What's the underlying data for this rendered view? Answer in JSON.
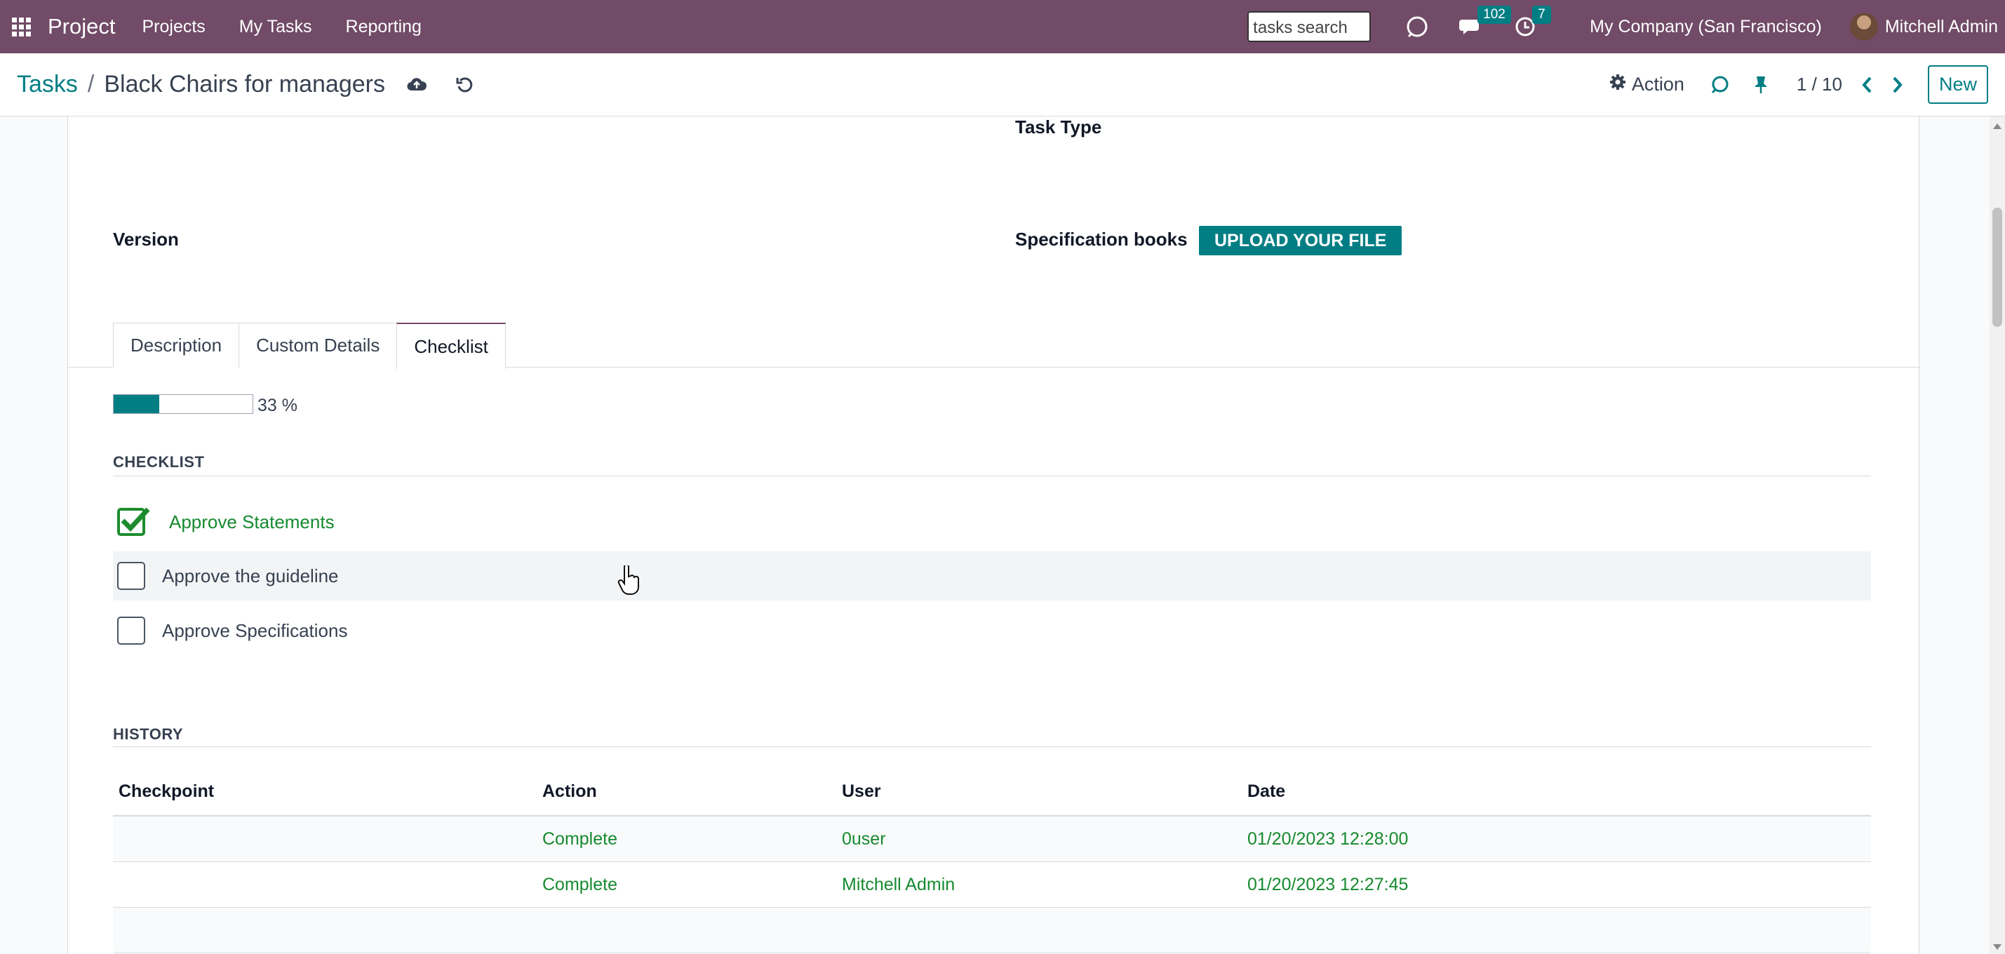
{
  "navbar": {
    "brand": "Project",
    "menu": [
      "Projects",
      "My Tasks",
      "Reporting"
    ],
    "search_placeholder": "tasks search",
    "messages_count": "102",
    "activities_count": "7",
    "company": "My Company (San Francisco)",
    "user": "Mitchell Admin"
  },
  "breadcrumb": {
    "parent": "Tasks",
    "separator": "/",
    "current": "Black Chairs for managers"
  },
  "control": {
    "action_label": "Action",
    "pager": "1 / 10",
    "new_label": "New"
  },
  "form": {
    "task_type_label": "Task Type",
    "version_label": "Version",
    "spec_books_label": "Specification books",
    "upload_label": "UPLOAD YOUR FILE"
  },
  "tabs": [
    {
      "label": "Description",
      "active": false
    },
    {
      "label": "Custom Details",
      "active": false
    },
    {
      "label": "Checklist",
      "active": true
    }
  ],
  "checklist": {
    "progress_percent": 33,
    "progress_text": "33 %",
    "section_title": "CHECKLIST",
    "items": [
      {
        "label": "Approve Statements",
        "done": true
      },
      {
        "label": "Approve the guideline",
        "done": false
      },
      {
        "label": "Approve Specifications",
        "done": false
      }
    ]
  },
  "history": {
    "section_title": "HISTORY",
    "columns": [
      "Checkpoint",
      "Action",
      "User",
      "Date"
    ],
    "rows": [
      {
        "checkpoint": "",
        "action": "Complete",
        "user": "0user",
        "date": "01/20/2023 12:28:00"
      },
      {
        "checkpoint": "",
        "action": "Complete",
        "user": "Mitchell Admin",
        "date": "01/20/2023 12:27:45"
      }
    ]
  },
  "colors": {
    "navbar": "#714b67",
    "accent": "#017e84",
    "done_green": "#168a2f"
  }
}
